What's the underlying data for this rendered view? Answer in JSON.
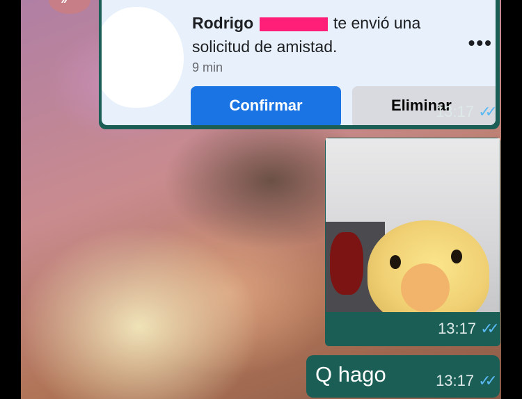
{
  "screenshot_card": {
    "name": "Rodrigo",
    "message_part1": "te envió una",
    "message_part2": "solicitud de amistad.",
    "time_ago": "9 min",
    "more_icon": "•••",
    "confirm_label": "Confirmar",
    "delete_label": "Eliminar"
  },
  "messages": {
    "screenshot_time": "13:17",
    "photo_time": "13:17",
    "text": "Q hago",
    "text_time": "13:17",
    "read_ticks": "✓✓"
  },
  "colors": {
    "bubble": "#1b5e56",
    "confirm_button": "#1b74e4",
    "read_ticks": "#5ab8f2"
  }
}
